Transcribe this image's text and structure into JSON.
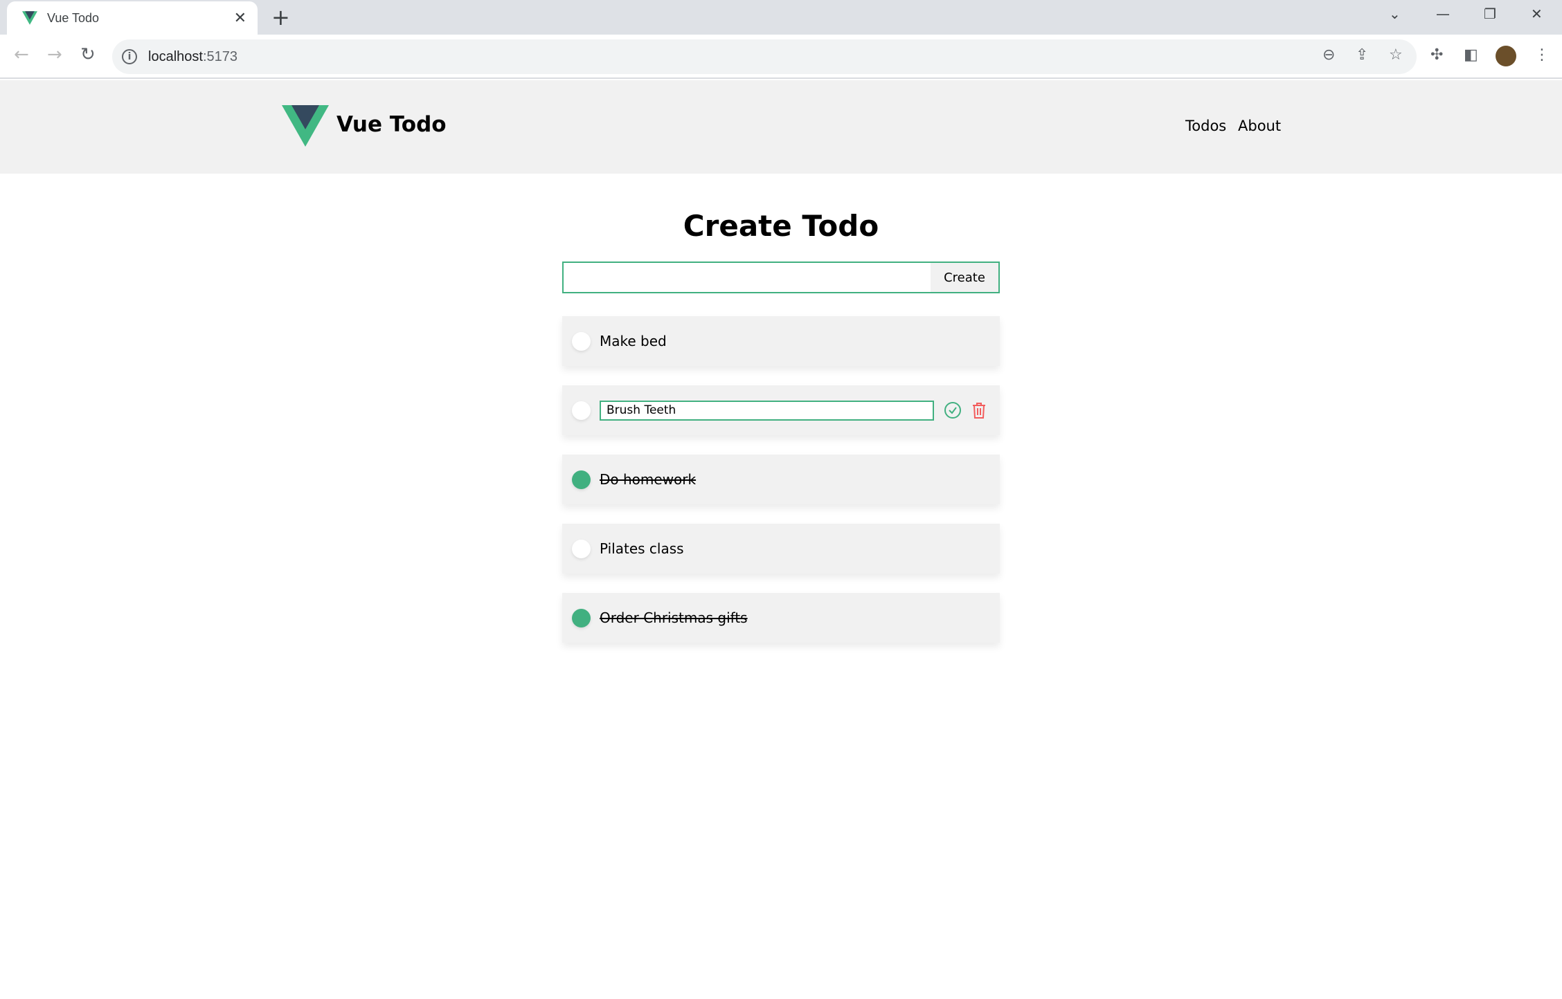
{
  "browser": {
    "tab_title": "Vue Todo",
    "url_host": "localhost",
    "url_port": ":5173"
  },
  "header": {
    "brand": "Vue Todo",
    "nav": [
      "Todos",
      "About"
    ]
  },
  "main": {
    "title": "Create Todo",
    "create_input_value": "",
    "create_button": "Create",
    "todos": [
      {
        "text": "Make bed",
        "completed": false,
        "editing": false
      },
      {
        "text": "Brush Teeth",
        "completed": false,
        "editing": true
      },
      {
        "text": "Do homework",
        "completed": true,
        "editing": false
      },
      {
        "text": "Pilates class",
        "completed": false,
        "editing": false
      },
      {
        "text": "Order Christmas gifts",
        "completed": true,
        "editing": false
      }
    ]
  },
  "colors": {
    "accent": "#41b080",
    "danger": "#f25c5c",
    "header_bg": "#f1f1f1"
  }
}
